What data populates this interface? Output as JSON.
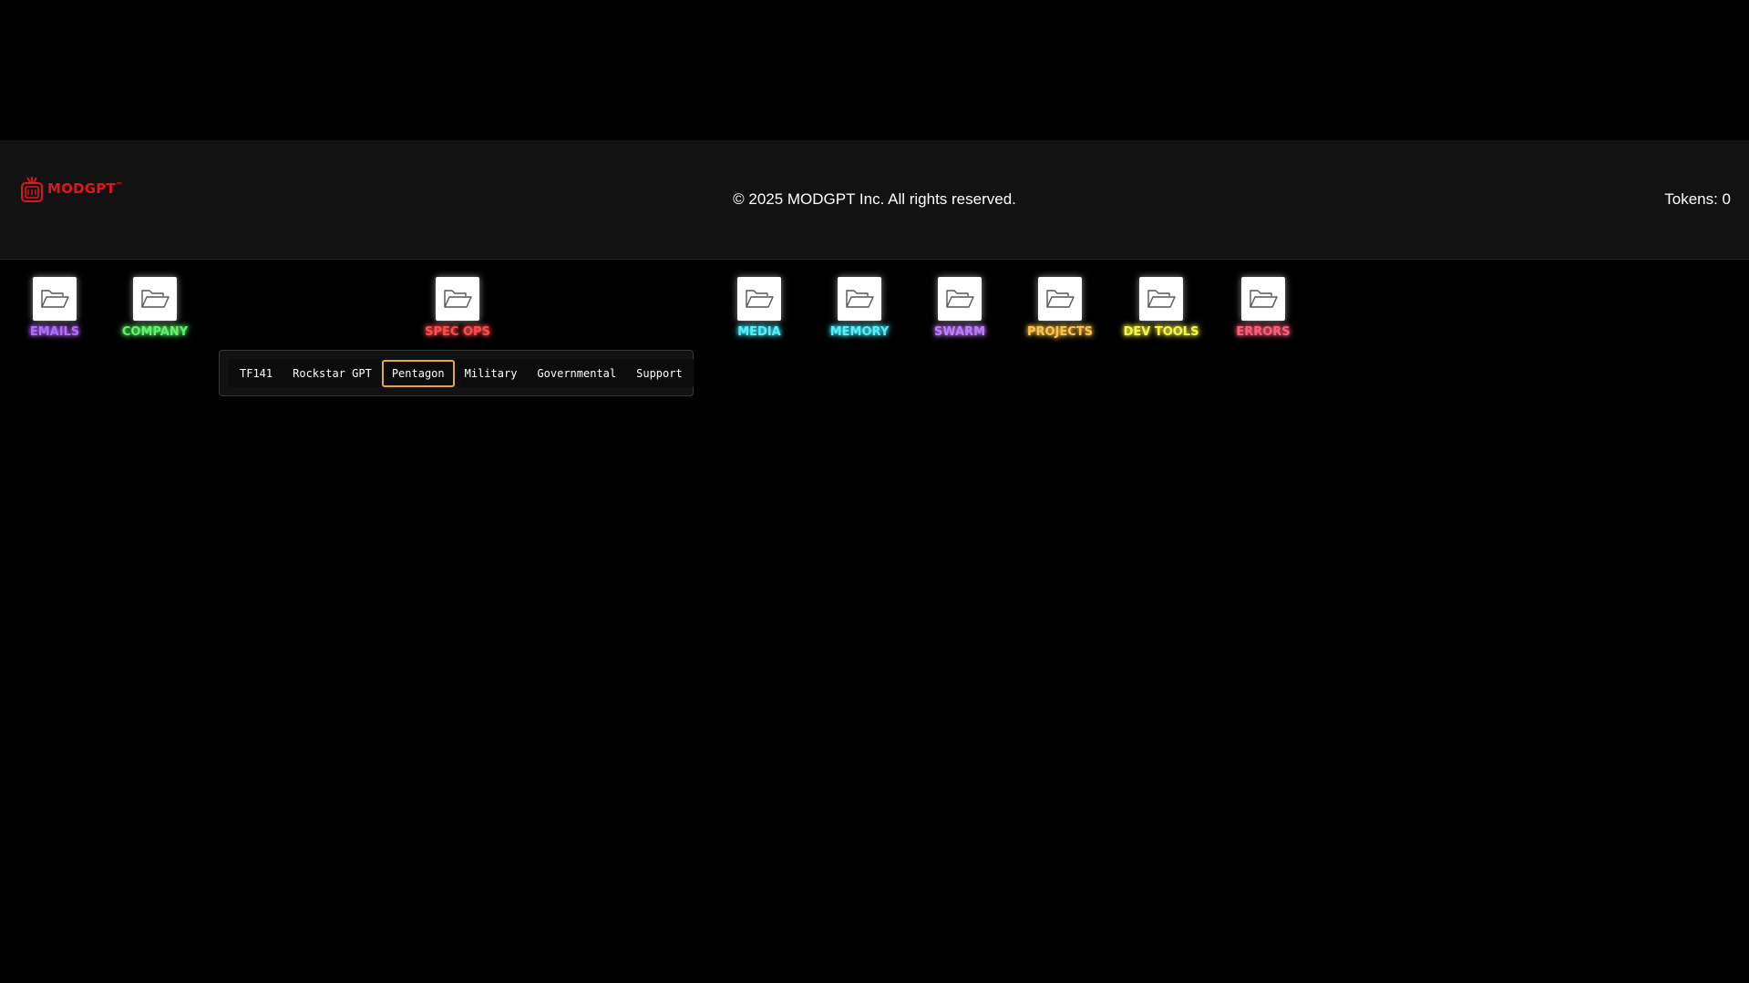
{
  "header": {
    "logo_text": "MODGPT",
    "logo_tm": "™",
    "copyright": "© 2025 MODGPT Inc. All rights reserved.",
    "tokens": "Tokens: 0",
    "logo_color": "#e0161b"
  },
  "folders": [
    {
      "label": "EMAILS",
      "color": "#b46cff",
      "icon": "folder-open-icon"
    },
    {
      "label": "COMPANY",
      "color": "#5ff56a",
      "icon": "folder-open-icon"
    },
    {
      "label": "SPEC OPS",
      "color": "#ff4b4b",
      "icon": "folder-open-icon"
    },
    {
      "label": "MEDIA",
      "color": "#52f0ff",
      "icon": "folder-open-icon"
    },
    {
      "label": "MEMORY",
      "color": "#52f0ff",
      "icon": "folder-open-icon"
    },
    {
      "label": "SWARM",
      "color": "#c27bff",
      "icon": "folder-open-icon"
    },
    {
      "label": "PROJECTS",
      "color": "#ffc34d",
      "icon": "folder-open-icon"
    },
    {
      "label": "DEV TOOLS",
      "color": "#f5f54a",
      "icon": "folder-open-icon"
    },
    {
      "label": "ERRORS",
      "color": "#ff5c7a",
      "icon": "folder-open-icon"
    }
  ],
  "spec_ops_menu": {
    "items": [
      "TF141",
      "Rockstar GPT",
      "Pentagon",
      "Military",
      "Governmental",
      "Support"
    ],
    "active": "Pentagon",
    "active_border_color": "#e8a73a"
  }
}
